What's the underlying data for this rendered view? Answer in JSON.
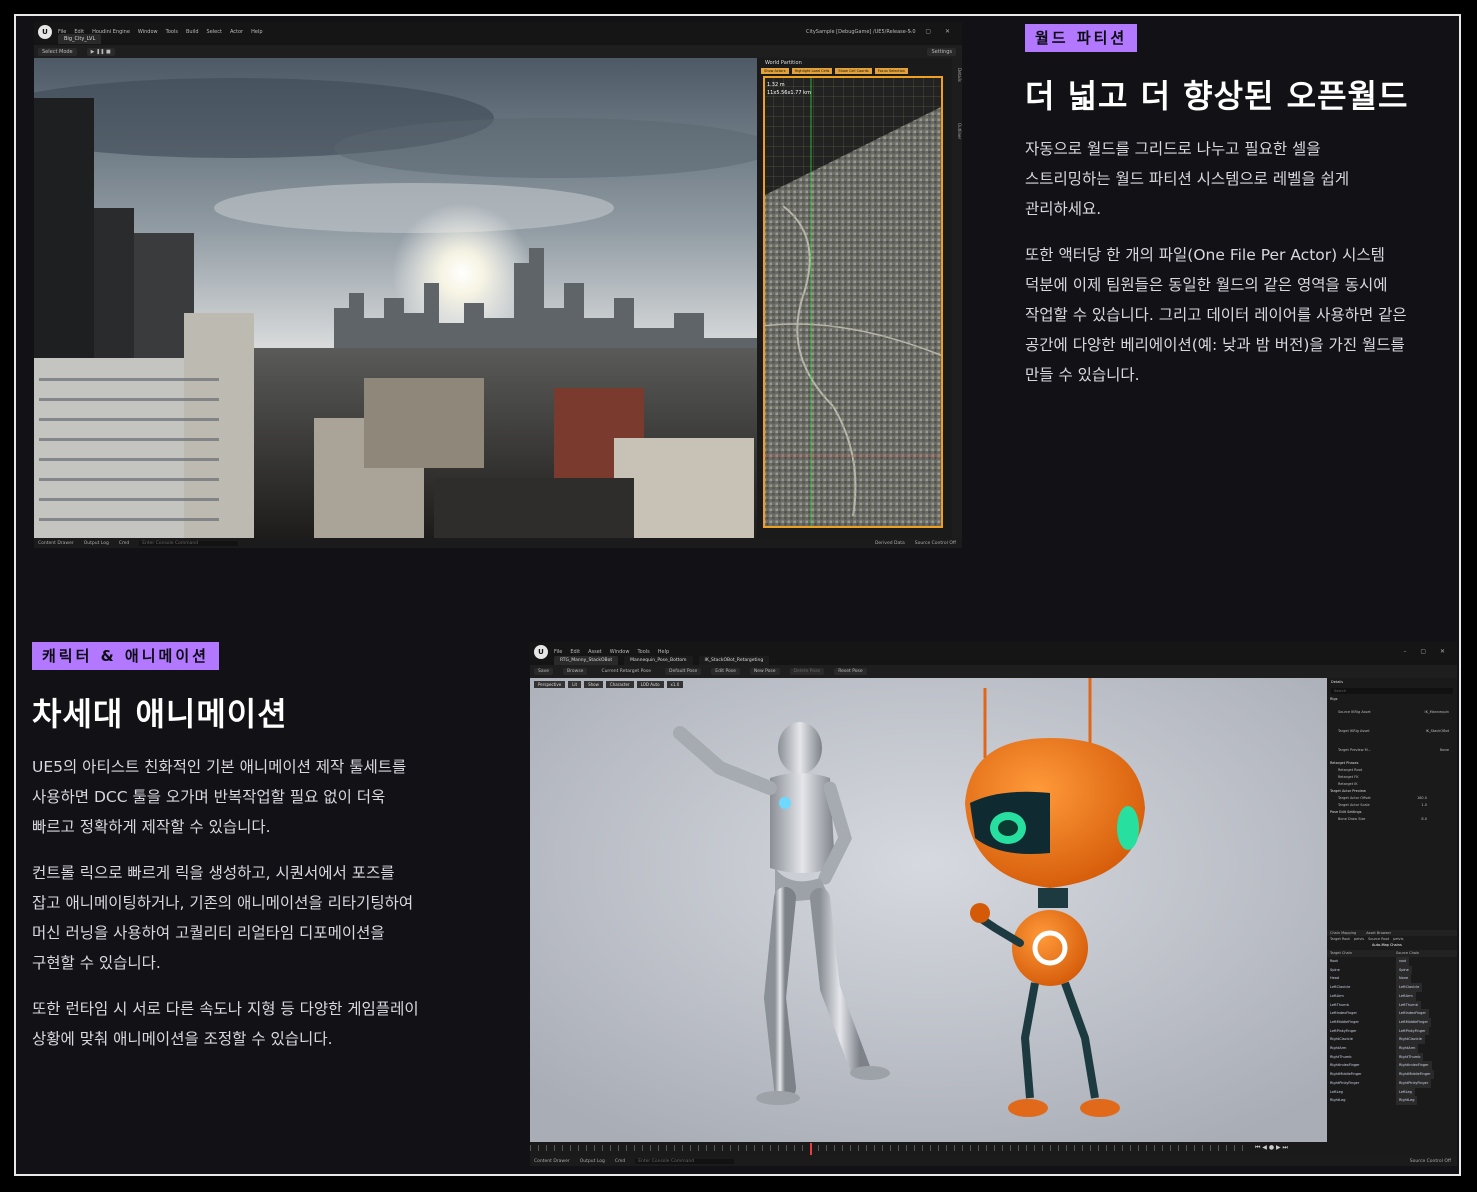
{
  "section1": {
    "badge": "월드 파티션",
    "title": "더 넓고 더 향상된 오픈월드",
    "paragraphs": [
      "자동으로 월드를 그리드로 나누고 필요한 셀을 스트리밍하는 월드 파티션 시스템으로 레벨을 쉽게 관리하세요.",
      "또한 액터당 한 개의 파일(One File Per Actor) 시스템 덕분에 이제 팀원들은 동일한 월드의 같은 영역을 동시에 작업할 수 있습니다. 그리고 데이터 레이어를 사용하면 같은 공간에 다양한 베리에이션(예: 낮과 밤 버전)을 가진 월드를 만들 수 있습니다."
    ],
    "para_lines": [
      [
        "자동으로 월드를 그리드로 나누고 필요한 셀을",
        "스트리밍하는 월드 파티션 시스템으로 레벨을 쉽게",
        "관리하세요."
      ],
      [
        "또한 액터당 한 개의 파일(One File Per Actor) 시스템",
        "덕분에 이제 팀원들은 동일한 월드의 같은 영역을 동시에",
        "작업할 수 있습니다. 그리고 데이터 레이어를 사용하면 같은",
        "공간에 다양한 베리에이션(예: 낮과 밤 버전)을 가진 월드를",
        "만들 수 있습니다."
      ]
    ]
  },
  "section2": {
    "badge": "캐릭터 & 애니메이션",
    "title": "차세대 애니메이션",
    "para_lines": [
      [
        "UE5의 아티스트 친화적인 기본 애니메이션 제작 툴세트를",
        "사용하면 DCC 툴을 오가며 반복작업할 필요 없이 더욱",
        "빠르고 정확하게 제작할 수 있습니다."
      ],
      [
        "컨트롤 릭으로 빠르게 릭을 생성하고, 시퀀서에서 포즈를",
        "잡고 애니메이팅하거나, 기존의 애니메이션을 리타기팅하여",
        "머신 러닝을 사용하여 고퀄리티 리얼타임 디포메이션을",
        "구현할 수 있습니다."
      ],
      [
        "또한 런타임 시 서로 다른 속도나 지형 등 다양한 게임플레이",
        "상황에 맞춰 애니메이션을 조정할 수 있습니다."
      ]
    ]
  },
  "editor1": {
    "menu": [
      "File",
      "Edit",
      "Houdini Engine",
      "Window",
      "Tools",
      "Build",
      "Select",
      "Actor",
      "Help"
    ],
    "tab": "Big_City_LVL",
    "project": "CitySample [DebugGame] /UE5/Release-5.0",
    "toolbar": [
      "Select Mode",
      "Settings"
    ],
    "panel_title": "World Partition",
    "panel_buttons": [
      "Show Actors",
      "Highlight Load Cells",
      "Show Cell Coords",
      "Focus Selection"
    ],
    "panel_readout_1": "1.32 m",
    "panel_readout_2": "11x5.56x1.77 km",
    "side_tabs": [
      "Details",
      "Outliner"
    ],
    "status": [
      "Content Drawer",
      "Output Log",
      "Cmd",
      "Enter Console Command",
      "Derived Data",
      "Source Control Off"
    ]
  },
  "editor2": {
    "menu": [
      "File",
      "Edit",
      "Asset",
      "Window",
      "Tools",
      "Help"
    ],
    "tabs": [
      "RTG_Manny_StackOBot",
      "Mannequin_Pose_Bottom",
      "IK_StackOBot_Retargeting"
    ],
    "toolbar": [
      "Save",
      "Browse",
      "Current Retarget Pose",
      "Default Pose",
      "Edit Pose",
      "New Pose",
      "Delete Pose",
      "Reset Pose"
    ],
    "viewport_buttons": [
      "Perspective",
      "Lit",
      "Show",
      "Character",
      "LOD Auto",
      "x1.0"
    ],
    "details_title": "Details",
    "search_placeholder": "Search",
    "details_sections": [
      "Rigs",
      "Retarget Phases",
      "Target Actor Preview",
      "Pose Edit Settings"
    ],
    "details_rows": [
      {
        "label": "Source IKRig Asset",
        "value": "IK_Mannequin"
      },
      {
        "label": "Target IKRig Asset",
        "value": "IK_StackOBot"
      },
      {
        "label": "Target Preview M...",
        "value": "None"
      },
      {
        "label": "Retarget Root",
        "value": ""
      },
      {
        "label": "Retarget FK",
        "value": ""
      },
      {
        "label": "Retarget IK",
        "value": ""
      },
      {
        "label": "Target Actor Offset",
        "value": "180.0"
      },
      {
        "label": "Target Actor Scale",
        "value": "1.0"
      },
      {
        "label": "Bone Draw Size",
        "value": "8.0"
      }
    ],
    "chain_tabs": [
      "Chain Mapping",
      "Asset Browser"
    ],
    "chain_header": [
      "Target Root",
      "pelvis",
      "Source Root",
      "pelvis"
    ],
    "auto_map": "Auto-Map Chains",
    "chain_columns": [
      "Target Chain",
      "Source Chain"
    ],
    "chains": [
      [
        "Root",
        "root"
      ],
      [
        "Spine",
        "Spine"
      ],
      [
        "Head",
        "None"
      ],
      [
        "LeftClavicle",
        "LeftClavicle"
      ],
      [
        "LeftArm",
        "LeftArm"
      ],
      [
        "LeftThumb",
        "LeftThumb"
      ],
      [
        "LeftIndexFinger",
        "LeftIndexFinger"
      ],
      [
        "LeftMiddleFinger",
        "LeftMiddleFinger"
      ],
      [
        "LeftPinkyFinger",
        "LeftPinkyFinger"
      ],
      [
        "RightClavicle",
        "RightClavicle"
      ],
      [
        "RightArm",
        "RightArm"
      ],
      [
        "RightThumb",
        "RightThumb"
      ],
      [
        "RightIndexFinger",
        "RightIndexFinger"
      ],
      [
        "RightMiddleFinger",
        "RightMiddleFinger"
      ],
      [
        "RightPinkyFinger",
        "RightPinkyFinger"
      ],
      [
        "LeftLeg",
        "LeftLeg"
      ],
      [
        "RightLeg",
        "RightLeg"
      ]
    ],
    "status": [
      "Content Drawer",
      "Output Log",
      "Cmd",
      "Enter Console Command",
      "Source Control Off"
    ]
  }
}
